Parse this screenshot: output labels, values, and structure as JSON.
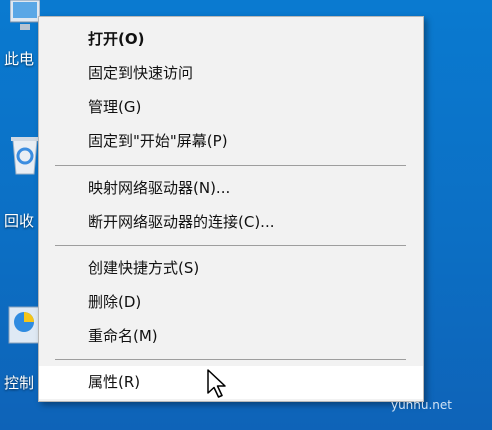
{
  "desktop": {
    "icons": [
      {
        "label": "此电"
      },
      {
        "label": "回收"
      },
      {
        "label": "控制"
      }
    ]
  },
  "context_menu": {
    "items": [
      {
        "label": "打开(O)"
      },
      {
        "label": "固定到快速访问"
      },
      {
        "label": "管理(G)"
      },
      {
        "label": "固定到\"开始\"屏幕(P)"
      },
      {
        "label": "映射网络驱动器(N)..."
      },
      {
        "label": "断开网络驱动器的连接(C)..."
      },
      {
        "label": "创建快捷方式(S)"
      },
      {
        "label": "删除(D)"
      },
      {
        "label": "重命名(M)"
      },
      {
        "label": "属性(R)"
      }
    ]
  },
  "watermark": "yunhu.net"
}
